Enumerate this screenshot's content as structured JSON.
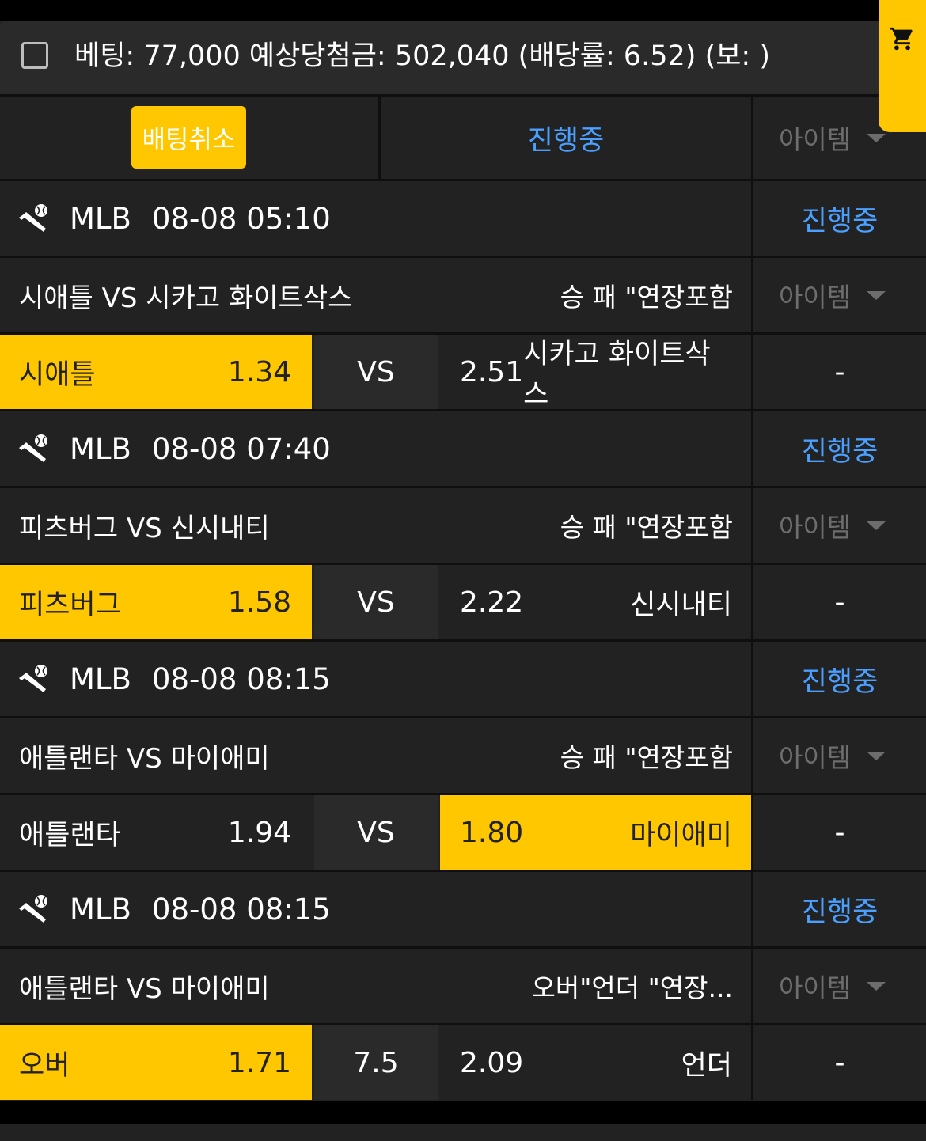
{
  "summary": {
    "text": "베팅: 77,000 예상당첨금: 502,040 (배당률: 6.52) (보: )"
  },
  "actions": {
    "cancel_label": "배팅취소",
    "status_label": "진행중",
    "item_label": "아이템"
  },
  "games": [
    {
      "league": "MLB",
      "datetime": "08-08 05:10",
      "status": "진행중",
      "matchup": "시애틀 VS 시카고 화이트삭스",
      "bet_type": "승 패 \"연장포함",
      "item": "아이템",
      "home_team": "시애틀",
      "home_odds": "1.34",
      "middle": "VS",
      "away_odds": "2.51",
      "away_team": "시카고 화이트삭스",
      "selected": "home",
      "result": "-"
    },
    {
      "league": "MLB",
      "datetime": "08-08 07:40",
      "status": "진행중",
      "matchup": "피츠버그 VS 신시내티",
      "bet_type": "승 패 \"연장포함",
      "item": "아이템",
      "home_team": "피츠버그",
      "home_odds": "1.58",
      "middle": "VS",
      "away_odds": "2.22",
      "away_team": "신시내티",
      "selected": "home",
      "result": "-"
    },
    {
      "league": "MLB",
      "datetime": "08-08 08:15",
      "status": "진행중",
      "matchup": "애틀랜타 VS 마이애미",
      "bet_type": "승 패 \"연장포함",
      "item": "아이템",
      "home_team": "애틀랜타",
      "home_odds": "1.94",
      "middle": "VS",
      "away_odds": "1.80",
      "away_team": "마이애미",
      "selected": "away",
      "result": "-"
    },
    {
      "league": "MLB",
      "datetime": "08-08 08:15",
      "status": "진행중",
      "matchup": "애틀랜타 VS 마이애미",
      "bet_type": "오버\"언더 \"연장...",
      "item": "아이템",
      "home_team": "오버",
      "home_odds": "1.71",
      "middle": "7.5",
      "away_odds": "2.09",
      "away_team": "언더",
      "selected": "home",
      "result": "-"
    }
  ],
  "colors": {
    "accent": "#ffc700",
    "link": "#4a9fff",
    "panel": "#222222",
    "muted": "#6d6d6d"
  },
  "icons": {
    "cart": "shopping-cart-icon",
    "sport": "baseball-icon",
    "checkbox": "checkbox-icon",
    "caret": "caret-down-icon"
  }
}
